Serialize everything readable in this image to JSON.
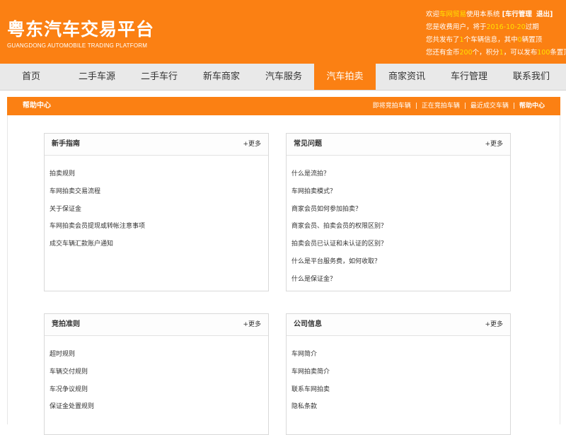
{
  "header": {
    "logo_cn": "粤东汽车交易平台",
    "logo_en": "GUANGDONG AUTOMOBILE TRADING PLATFORM",
    "userinfo": {
      "line1_a": "欢迎",
      "line1_hl": "车网贸易",
      "line1_b": "使用本系统 ",
      "line1_mgmt": "[车行管理",
      "line1_logout": "退出]",
      "line2_a": "您是收费用户，将于",
      "line2_hl": "2016-10-20",
      "line2_b": "过期",
      "line3_a": "您共发布了",
      "line3_hl1": "1",
      "line3_b": "个车辆信息，其中",
      "line3_hl2": "0",
      "line3_c": "辆置顶",
      "line4_a": "您还有金币",
      "line4_hl1": "200",
      "line4_b": "个，积分",
      "line4_hl2": "1",
      "line4_c": "，可以发布",
      "line4_hl3": "100",
      "line4_d": "条置顶信息"
    }
  },
  "nav": {
    "items": [
      "首页",
      "二手车源",
      "二手车行",
      "新车商家",
      "汽车服务",
      "汽车拍卖",
      "商家资讯",
      "车行管理",
      "联系我们"
    ],
    "active_index": 5
  },
  "subbar": {
    "title": "帮助中心",
    "links": [
      "即将竞拍车辆",
      "正在竞拍车辆",
      "最近成交车辆",
      "帮助中心"
    ]
  },
  "panels": {
    "guide": {
      "title": "新手指南",
      "more": "+更多",
      "items": [
        "拍卖规则",
        "车网拍卖交易流程",
        "关于保证金",
        "车网拍卖会员提现或转帐注意事项",
        "成交车辆汇款账户通知"
      ]
    },
    "faq": {
      "title": "常见问题",
      "more": "+更多",
      "items": [
        "什么是流拍？",
        "车网拍卖模式？",
        "商家会员如何参加拍卖？",
        "商家会员、拍卖会员的权限区别？",
        "拍卖会员已认证和未认证的区别？",
        "什么是平台服务费，如何收取？",
        "什么是保证金？"
      ]
    },
    "rules": {
      "title": "竞拍准则",
      "more": "+更多",
      "items": [
        "超时规则",
        "车辆交付规则",
        "车况争议规则",
        "保证金处置规则"
      ]
    },
    "company": {
      "title": "公司信息",
      "more": "+更多",
      "items": [
        "车网简介",
        "车网拍卖简介",
        "联系车网拍卖",
        "隐私条款"
      ]
    }
  },
  "colors": {
    "brand_orange": "#fb8013",
    "highlight_yellow": "#ffe100",
    "nav_bg": "#e9e9e9"
  }
}
